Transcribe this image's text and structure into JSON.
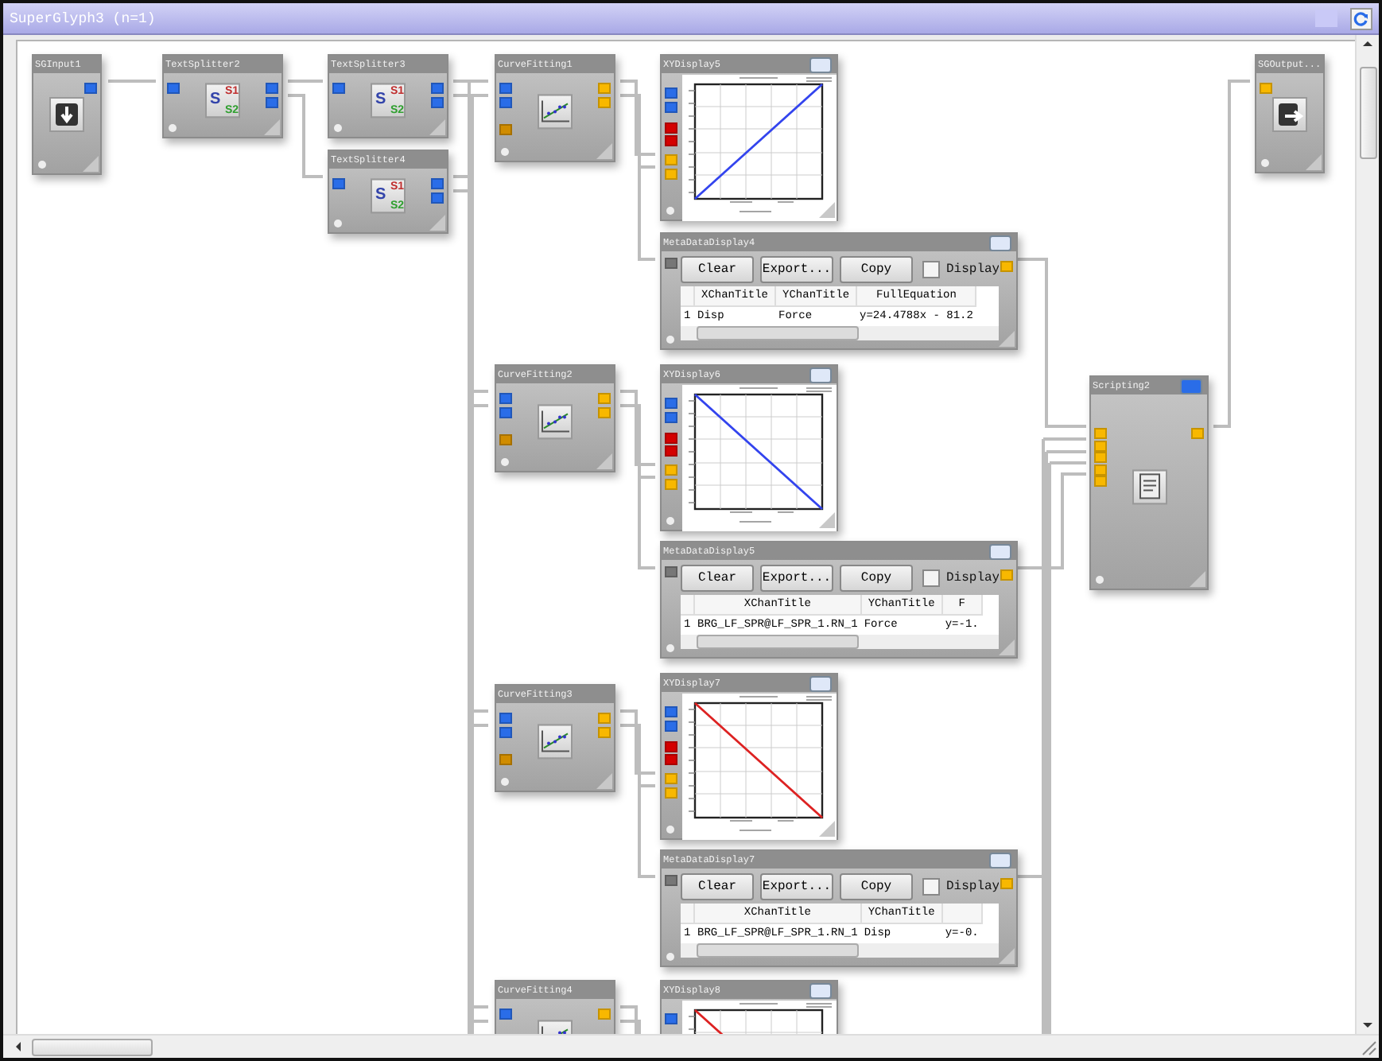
{
  "window": {
    "title": "SuperGlyph3 (n=1)"
  },
  "nodes": [
    {
      "kind": "input",
      "title": "SGInput1"
    },
    {
      "kind": "splitter",
      "title": "TextSplitter2",
      "icon_labels": [
        "S",
        "S1",
        "S2"
      ]
    },
    {
      "kind": "splitter",
      "title": "TextSplitter3",
      "icon_labels": [
        "S",
        "S1",
        "S2"
      ]
    },
    {
      "kind": "splitter",
      "title": "TextSplitter4",
      "icon_labels": [
        "S",
        "S1",
        "S2"
      ]
    },
    {
      "kind": "fitting",
      "title": "CurveFitting1"
    },
    {
      "kind": "xy",
      "title": "XYDisplay5",
      "color": "#3344ee",
      "rising": true
    },
    {
      "kind": "meta",
      "title": "MetaDataDisplay4",
      "buttons": [
        "Clear",
        "Export...",
        "Copy"
      ],
      "checkbox": {
        "label": "Display",
        "checked": false
      },
      "columns": [
        "",
        "XChanTitle",
        "YChanTitle",
        "FullEquation"
      ],
      "rows": [
        [
          "1",
          "Disp",
          "Force",
          "y=24.4788x - 81.2"
        ]
      ]
    },
    {
      "kind": "fitting",
      "title": "CurveFitting2"
    },
    {
      "kind": "xy",
      "title": "XYDisplay6",
      "color": "#3344ee",
      "rising": false
    },
    {
      "kind": "meta",
      "title": "MetaDataDisplay5",
      "buttons": [
        "Clear",
        "Export...",
        "Copy"
      ],
      "checkbox": {
        "label": "Display",
        "checked": false
      },
      "columns": [
        "",
        "XChanTitle",
        "YChanTitle",
        "F"
      ],
      "rows": [
        [
          "1",
          "BRG_LF_SPR@LF_SPR_1.RN_1",
          "Force",
          "y=-1."
        ]
      ]
    },
    {
      "kind": "fitting",
      "title": "CurveFitting3"
    },
    {
      "kind": "xy",
      "title": "XYDisplay7",
      "color": "#dd2222",
      "rising": false
    },
    {
      "kind": "meta",
      "title": "MetaDataDisplay7",
      "buttons": [
        "Clear",
        "Export...",
        "Copy"
      ],
      "checkbox": {
        "label": "Display",
        "checked": false
      },
      "columns": [
        "",
        "XChanTitle",
        "YChanTitle"
      ],
      "rows": [
        [
          "1",
          "BRG_LF_SPR@LF_SPR_1.RN_1",
          "Disp",
          "y=-0."
        ]
      ]
    },
    {
      "kind": "fitting",
      "title": "CurveFitting4"
    },
    {
      "kind": "xy",
      "title": "XYDisplay8",
      "color": "#dd2222",
      "rising": false
    },
    {
      "kind": "script",
      "title": "Scripting2"
    },
    {
      "kind": "output",
      "title": "SGOutput..."
    }
  ]
}
